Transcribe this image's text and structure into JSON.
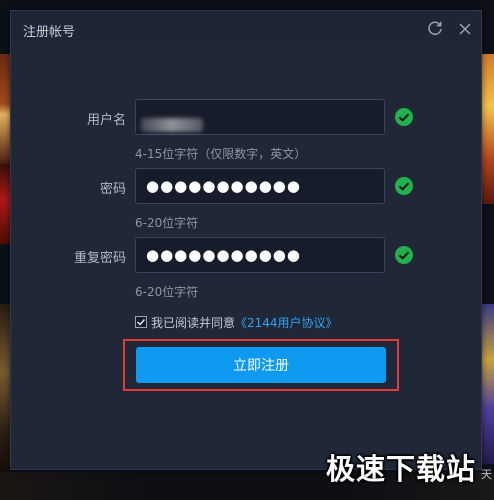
{
  "dialog": {
    "title": "注册帐号"
  },
  "form": {
    "username": {
      "label": "用户名",
      "value": "",
      "hint": "4-15位字符（仅限数字，英文）"
    },
    "password": {
      "label": "密码",
      "value": "●●●●●●●●●●●",
      "hint": "6-20位字符"
    },
    "confirm_password": {
      "label": "重复密码",
      "value": "●●●●●●●●●●●",
      "hint": "6-20位字符"
    },
    "agreement": {
      "text": "我已阅读并同意",
      "link": "《2144用户协议》",
      "checked": true
    },
    "submit_label": "立即注册"
  },
  "background": {
    "partial_char": "天"
  },
  "watermark": {
    "text": "极速下载站"
  },
  "colors": {
    "dialog_bg": "#202838",
    "accent_blue": "#0d9af0",
    "success_green": "#22b14c",
    "highlight_red": "#e53935",
    "link_blue": "#2fa0f0"
  },
  "icons": {
    "refresh": "refresh-icon",
    "close": "close-icon",
    "valid": "check-circle-icon",
    "checkbox": "checkmark-icon"
  }
}
